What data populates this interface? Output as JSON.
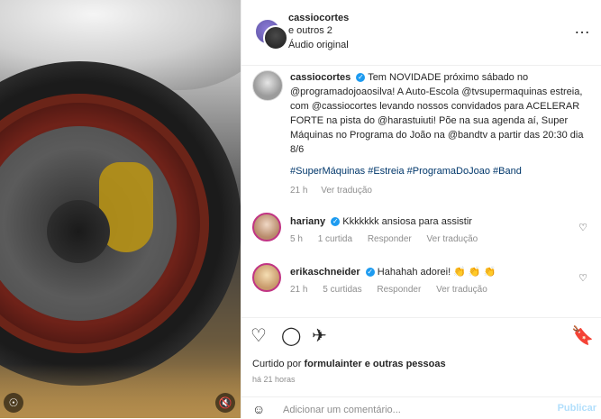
{
  "header": {
    "username": "cassiocortes",
    "collab": "e outros 2",
    "audio": "Áudio original",
    "menu": "…"
  },
  "caption": {
    "username": "cassiocortes",
    "text": "Tem NOVIDADE próximo sábado no @programadojoaosilva! A Auto-Escola @tvsupermaquinas estreia, com @cassiocortes levando nossos convidados para ACELERAR FORTE na pista do @harastuiuti! Põe na sua agenda aí, Super Máquinas no Programa do João na @bandtv a partir das 20:30 dia 8/6",
    "hashtags": "#SuperMáquinas #Estreia #ProgramaDoJoao #Band",
    "time": "21 h",
    "see_translation": "Ver tradução"
  },
  "comments": [
    {
      "username": "hariany",
      "text": "Kkkkkkk ansiosa para assistir",
      "time": "5 h",
      "likes": "1 curtida",
      "reply": "Responder",
      "see_translation": "Ver tradução"
    },
    {
      "username": "erikaschneider",
      "text": "Hahahah adorei! 👏 👏 👏",
      "time": "21 h",
      "likes": "5 curtidas",
      "reply": "Responder",
      "see_translation": "Ver tradução"
    }
  ],
  "actions": {
    "like_icon": "heart-icon",
    "comment_icon": "comment-icon",
    "share_icon": "share-icon",
    "save_icon": "bookmark-icon"
  },
  "likes": {
    "prefix": "Curtido por",
    "user": "formulainter",
    "suffix": "e outras pessoas"
  },
  "post_time": "há 21 horas",
  "add_comment": {
    "placeholder": "Adicionar um comentário...",
    "publish": "Publicar"
  }
}
